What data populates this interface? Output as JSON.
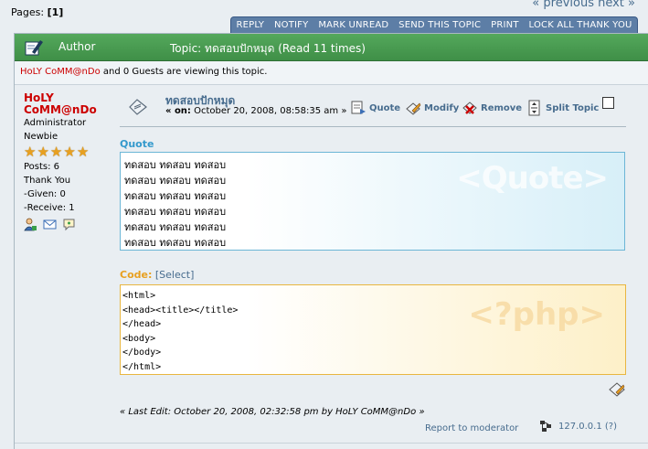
{
  "pagination": {
    "label": "Pages:",
    "current": "[1]",
    "prev": "« previous",
    "next": "next »"
  },
  "toolbar": [
    "REPLY",
    "NOTIFY",
    "MARK UNREAD",
    "SEND THIS TOPIC",
    "PRINT",
    "LOCK ALL THANK YOU"
  ],
  "header": {
    "author_label": "Author",
    "topic_text": "Topic: ทดสอบปักหมุด  (Read 11 times)"
  },
  "viewing": {
    "user": "HoLY CoMM@nDo",
    "rest": " and 0 Guests are viewing this topic."
  },
  "poster": {
    "name_line1": "HoLY",
    "name_line2": "CoMM@nDo",
    "group": "Administrator",
    "rank": "Newbie",
    "stars": 5,
    "posts": "Posts: 6",
    "thank_you": "Thank You",
    "given": "-Given: 0",
    "receive": "-Receive: 1"
  },
  "post": {
    "title": "ทดสอบปักหมุด",
    "on_label": "« on:",
    "date": " October 20, 2008, 08:58:35 am »",
    "actions": {
      "quote": "Quote",
      "modify": "Modify",
      "remove": "Remove",
      "split": "Split Topic"
    }
  },
  "quote": {
    "label": "Quote",
    "watermark": "<Quote>",
    "lines": [
      "ทดสอบ ทดสอบ ทดสอบ",
      "ทดสอบ ทดสอบ ทดสอบ",
      "ทดสอบ ทดสอบ ทดสอบ",
      "ทดสอบ ทดสอบ ทดสอบ",
      "ทดสอบ ทดสอบ ทดสอบ",
      "ทดสอบ ทดสอบ ทดสอบ"
    ]
  },
  "code": {
    "label": "Code:",
    "select": "[Select]",
    "watermark": "<?php>",
    "lines": [
      "<html>",
      "<head><title></title>",
      "</head>",
      "<body>",
      "</body>",
      "</html>"
    ]
  },
  "footer": {
    "last_edit": "« Last Edit: October 20, 2008, 02:32:58 pm by HoLY CoMM@nDo »",
    "report": "Report to moderator",
    "ip": "127.0.0.1 (?)"
  },
  "colors": {
    "header_green": "#4a9e52",
    "toolbar_blue": "#5d7ea6",
    "link": "#476c8e",
    "username_red": "#cc0000",
    "quote_label": "#3399cc",
    "code_label": "#e8a020"
  }
}
